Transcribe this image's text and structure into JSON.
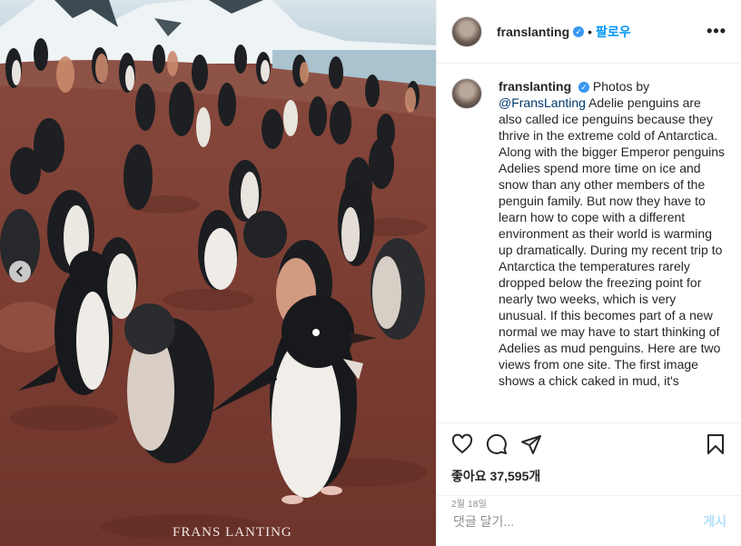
{
  "post": {
    "username": "franslanting",
    "follow_label": "팔로우",
    "more_label": "•••",
    "caption_text": "Photos by ",
    "caption_mention": "@FransLanting",
    "caption_body": " Adelie penguins are also called ice penguins because they thrive in the extreme cold of Antarctica. Along with the bigger Emperor penguins Adelies spend more time on ice and snow than any other members of the penguin family. But now they have to learn how to cope with a different environment as their world is warming up dramatically. During my recent trip to Antarctica the temperatures rarely dropped below the freezing point for nearly two weeks, which is very unusual. If this becomes part of a new normal we may have to start thinking of Adelies as mud penguins. Here are two views from one site. The first image shows a chick caked in mud, it's",
    "likes_label": "좋아요 37,595개",
    "date_label": "2월 18일",
    "comment_placeholder": "댓글 달기...",
    "post_button_label": "게시",
    "watermark": "FRANS LANTING"
  },
  "icons": {
    "like": "heart-icon",
    "comment": "comment-icon",
    "share": "paper-plane-icon",
    "save": "bookmark-icon",
    "carousel_prev": "chevron-left-icon",
    "verified": "verified-badge-icon"
  },
  "colors": {
    "link_blue": "#0095f6",
    "verified_blue": "#3897f0",
    "post_button_disabled": "#b2dffc",
    "mud": "#7a3f34"
  }
}
